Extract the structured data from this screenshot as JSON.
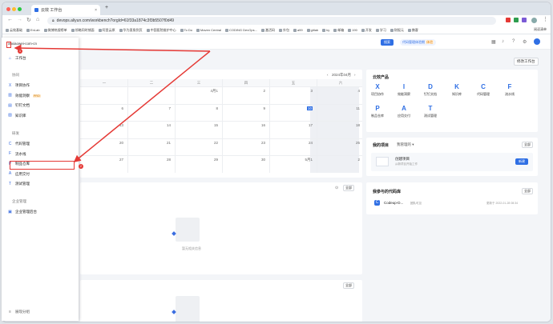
{
  "browser": {
    "tab_title": "云效 工作台",
    "new_tab": "+",
    "url": "devops.aliyun.com/workbench?orgId=61f33a1874c3f3b5507f0d49",
    "bookmarks": [
      "云效基础",
      "EnLab",
      "微博热搜榜单",
      "领略同时铺面",
      "阿里云原",
      "华为直角到页",
      "中国医院维护中心",
      "To Do",
      "Maven Central",
      "CODING DevOps...",
      "激活码",
      "外包",
      "a99",
      "gitlab",
      "ky",
      "邮箱",
      "190",
      "开发",
      "学习",
      "财报元",
      "携客"
    ],
    "reading_list": "阅读清单"
  },
  "header": {
    "search": "搜索",
    "org_label": "代码管理体验期",
    "org_tag": "体验",
    "notice_count": "99+"
  },
  "sidebar": {
    "org": "xuxiaowei-com-cn",
    "workbench": "工作台",
    "section_collab": "协同",
    "collab_items": [
      "项目协作",
      "效能洞察",
      "钉钉文档",
      "知识库"
    ],
    "pro_badge": "PRO",
    "section_dev": "研发",
    "dev_items": [
      "代码管理",
      "流水线",
      "制品仓库",
      "应用交付",
      "测试管理"
    ],
    "section_admin": "企业管理",
    "admin_items": [
      "企业管理后台"
    ],
    "footer": "展现分组"
  },
  "workbench": {
    "edit_button": "修改工作台",
    "calendar": {
      "month_label": "2024年04月",
      "prev": "‹",
      "next": "›",
      "weekdays": [
        "一",
        "二",
        "三",
        "四",
        "五",
        "六"
      ],
      "rows": [
        [
          "",
          "",
          "4月1",
          "2",
          "3",
          "4"
        ],
        [
          "6",
          "7",
          "8",
          "9",
          "10",
          "11"
        ],
        [
          "13",
          "14",
          "15",
          "16",
          "17",
          "18"
        ],
        [
          "20",
          "21",
          "22",
          "23",
          "24",
          "25"
        ],
        [
          "27",
          "28",
          "29",
          "30",
          "5月1",
          "2"
        ]
      ]
    },
    "card2": {
      "all": "全部",
      "empty": "暂无相关信息"
    },
    "card3": {
      "all": "全部"
    }
  },
  "right": {
    "products_title": "云效产品",
    "products": [
      {
        "name": "项目协作",
        "icon": "X"
      },
      {
        "name": "效能洞察",
        "icon": "I"
      },
      {
        "name": "钉钉文档",
        "icon": "D"
      },
      {
        "name": "知识库",
        "icon": "K"
      },
      {
        "name": "代码管理",
        "icon": "C"
      },
      {
        "name": "流水线",
        "icon": "F"
      },
      {
        "name": "制品仓库",
        "icon": "P"
      },
      {
        "name": "应用交付",
        "icon": "A"
      },
      {
        "name": "测试管理",
        "icon": "T"
      }
    ],
    "projects_title": "我的项目",
    "projects_filter": "我管理的",
    "projects_all": "全部",
    "create_project": "创建项目",
    "create_sub": "从新项目开始工作",
    "create_btn": "新建",
    "repos_title": "我参与的代码库",
    "repos_all": "全部",
    "repo_name": "Codeup-D...",
    "repo_tag": "团队可见",
    "repo_time": "更新于 2022-01-28 08:34"
  },
  "annotations": {
    "badge1": "1",
    "badge2": "2"
  }
}
